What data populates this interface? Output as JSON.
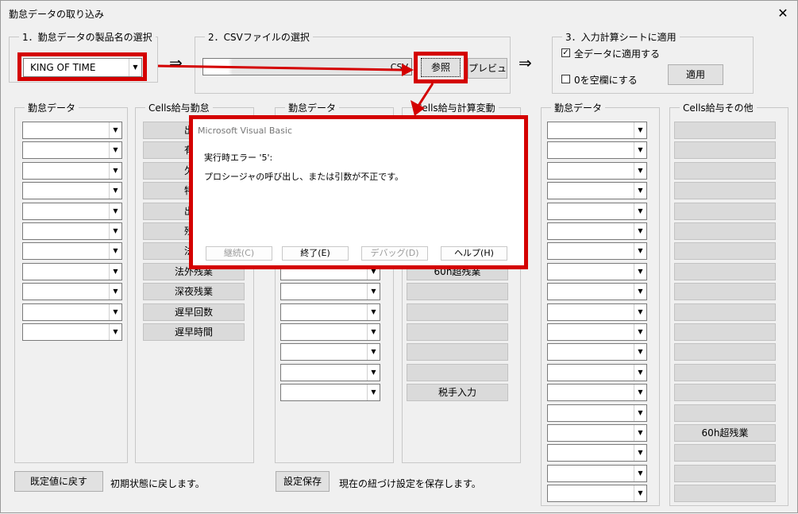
{
  "window": {
    "title": "勤怠データの取り込み",
    "close": "✕"
  },
  "section1": {
    "label": "1．勤怠データの製品名の選択",
    "product_value": "KING OF TIME"
  },
  "arrow1": "⇒",
  "section2": {
    "label": "2．CSVファイルの選択",
    "file_path": "CSV",
    "browse_label": "参照",
    "preview_label": "プレビュー"
  },
  "arrow2": "⇒",
  "section3": {
    "label": "3．入力計算シートに適用",
    "apply_all_label": "全データに適用する",
    "apply_all_checked": true,
    "zero_blank_label": "0を空欄にする",
    "zero_blank_checked": false,
    "apply_button": "適用"
  },
  "colA": {
    "label": "勤怠データ"
  },
  "colB": {
    "label": "Cells給与勤怠",
    "items": [
      "出勤",
      "有給",
      "欠勤",
      "特別",
      "出勤",
      "残業",
      "法内",
      "法外残業",
      "深夜残業",
      "遅早回数",
      "遅早時間"
    ]
  },
  "colC": {
    "label": "勤怠データ"
  },
  "colD": {
    "label": "Cells給与計算変動",
    "items": [
      "",
      "",
      "",
      "",
      "",
      "",
      "",
      "60h超残業",
      "",
      "",
      "",
      "",
      "",
      "税手入力"
    ]
  },
  "colE": {
    "label": "勤怠データ"
  },
  "colF": {
    "label": "Cells給与その他",
    "items": [
      "",
      "",
      "",
      "",
      "",
      "",
      "",
      "",
      "",
      "",
      "",
      "",
      "",
      "",
      "",
      "60h超残業",
      "",
      "",
      ""
    ]
  },
  "footer": {
    "reset_button": "既定値に戻す",
    "reset_desc": "初期状態に戻します。",
    "save_button": "設定保存",
    "save_desc": "現在の紐づけ設定を保存します。"
  },
  "dialog": {
    "title": "Microsoft Visual Basic",
    "message1": "実行時エラー '5':",
    "message2": "プロシージャの呼び出し、または引数が不正です。",
    "buttons": {
      "continue": "継続(C)",
      "end": "終了(E)",
      "debug": "デバッグ(D)",
      "help": "ヘルプ(H)"
    }
  },
  "colors": {
    "highlight": "#d40000",
    "cell_bg": "#dadada",
    "window_bg": "#f0f0f0"
  }
}
